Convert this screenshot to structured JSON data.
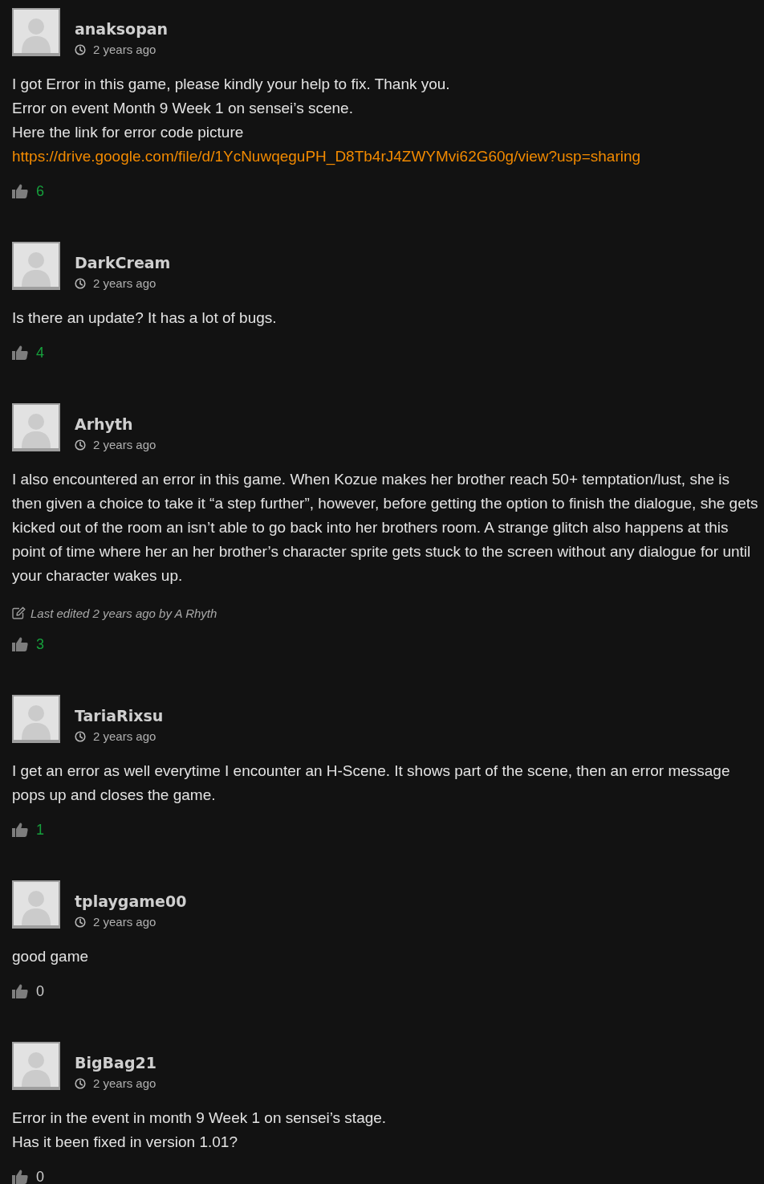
{
  "comments": [
    {
      "author": "anaksopan",
      "time": "2 years ago",
      "body": [
        {
          "kind": "text",
          "text": "I got Error in this game, please kindly your help to fix. Thank you."
        },
        {
          "kind": "text",
          "text": "Error on event Month 9 Week 1 on sensei’s scene."
        },
        {
          "kind": "text",
          "text": "Here the link for error code picture"
        },
        {
          "kind": "link",
          "text": "https://drive.google.com/file/d/1YcNuwqeguPH_D8Tb4rJ4ZWYMvi62G60g/view?usp=sharing"
        }
      ],
      "likes": {
        "count": "6",
        "color": "#16a03c"
      }
    },
    {
      "author": "DarkCream",
      "time": "2 years ago",
      "body": [
        {
          "kind": "text",
          "text": "Is there an update? It has a lot of bugs."
        }
      ],
      "likes": {
        "count": "4",
        "color": "#16a03c"
      }
    },
    {
      "author": "Arhyth",
      "time": "2 years ago",
      "body": [
        {
          "kind": "text",
          "text": "I also encountered an error in this game. When Kozue makes her brother reach 50+ temptation/lust, she is then given a choice to take it “a step further”, however, before getting the option to finish the dialogue, she gets kicked out of the room an isn’t able to go back into her brothers room. A strange glitch also happens at this point of time where her an her brother’s character sprite gets stuck to the screen without any dialogue for until your character wakes up."
        }
      ],
      "edited": "Last edited 2 years ago by A Rhyth",
      "likes": {
        "count": "3",
        "color": "#16a03c"
      }
    },
    {
      "author": "TariaRixsu",
      "time": "2 years ago",
      "body": [
        {
          "kind": "text",
          "text": "I get an error as well everytime I encounter an H-Scene. It shows part of the scene, then an error message pops up and closes the game."
        }
      ],
      "likes": {
        "count": "1",
        "color": "#16a03c"
      }
    },
    {
      "author": "tplaygame00",
      "time": "2 years ago",
      "body": [
        {
          "kind": "text",
          "text": "good game"
        }
      ],
      "likes": {
        "count": "0",
        "color": "#cfcfcf"
      }
    },
    {
      "author": "BigBag21",
      "time": "2 years ago",
      "body": [
        {
          "kind": "text",
          "text": "Error in the event in month 9 Week 1 on sensei’s stage."
        },
        {
          "kind": "text",
          "text": "Has it been fixed in version 1.01?"
        }
      ],
      "likes": {
        "count": "0",
        "color": "#cfcfcf"
      }
    }
  ]
}
